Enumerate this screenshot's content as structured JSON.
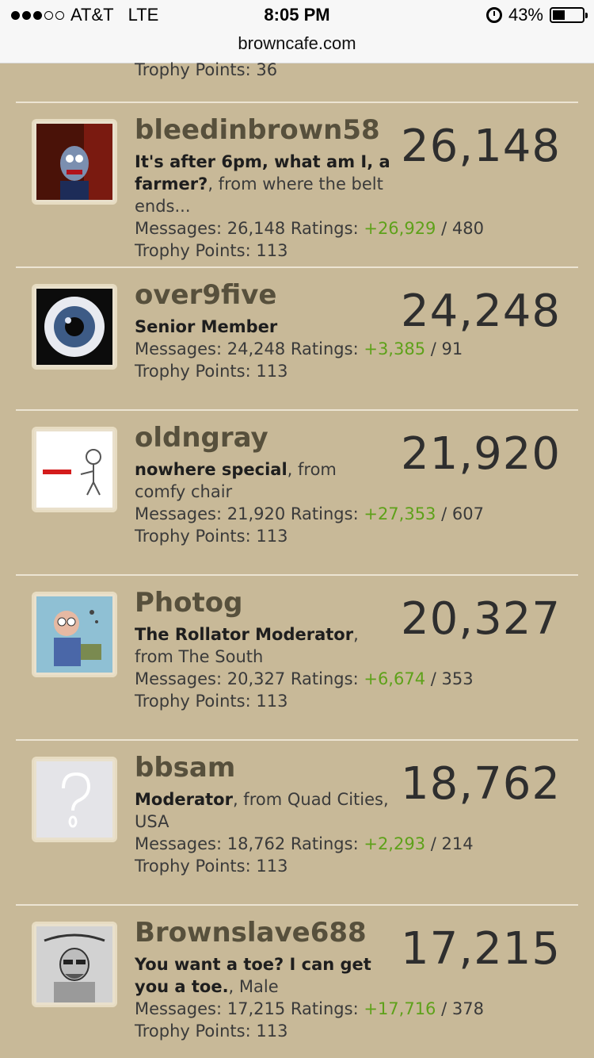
{
  "status_bar": {
    "carrier": "AT&T",
    "network": "LTE",
    "time": "8:05 PM",
    "battery": "43%",
    "battery_level": 0.43,
    "url": "browncafe.com"
  },
  "top_partial": {
    "trophy_text": "Trophy Points: 36"
  },
  "labels": {
    "messages": "Messages:",
    "ratings": "Ratings:",
    "trophy": "Trophy Points:",
    "slash": "/"
  },
  "members": [
    {
      "username": "bleedinbrown58",
      "count": "26,148",
      "title": "It's after 6pm, what am I, a farmer?",
      "location_suffix": ", from where the belt ends...",
      "messages": "26,148",
      "ratings_pos": "+26,929",
      "ratings_neg": "480",
      "trophy": "113",
      "avatar_icon": "muppet-avatar-icon"
    },
    {
      "username": "over9five",
      "count": "24,248",
      "title": "Senior Member",
      "location_suffix": "",
      "messages": "24,248",
      "ratings_pos": "+3,385",
      "ratings_neg": "91",
      "trophy": "113",
      "avatar_icon": "eyeball-avatar-icon"
    },
    {
      "username": "oldngray",
      "count": "21,920",
      "title": "nowhere special",
      "location_suffix": ", from comfy chair",
      "messages": "21,920",
      "ratings_pos": "+27,353",
      "ratings_neg": "607",
      "trophy": "113",
      "avatar_icon": "stick-figure-avatar-icon"
    },
    {
      "username": "Photog",
      "count": "20,327",
      "title": "The Rollator Moderator",
      "location_suffix": ", from The South",
      "messages": "20,327",
      "ratings_pos": "+6,674",
      "ratings_neg": "353",
      "trophy": "113",
      "avatar_icon": "cartoon-old-man-avatar-icon"
    },
    {
      "username": "bbsam",
      "count": "18,762",
      "title": "Moderator",
      "location_suffix": ", from Quad Cities, USA",
      "messages": "18,762",
      "ratings_pos": "+2,293",
      "ratings_neg": "214",
      "trophy": "113",
      "avatar_icon": "question-mark-avatar-icon"
    },
    {
      "username": "Brownslave688",
      "count": "17,215",
      "title": "You want a toe? I can get you a toe.",
      "location_suffix": ", Male",
      "messages": "17,215",
      "ratings_pos": "+17,716",
      "ratings_neg": "378",
      "trophy": "113",
      "avatar_icon": "walter-sketch-avatar-icon"
    }
  ]
}
